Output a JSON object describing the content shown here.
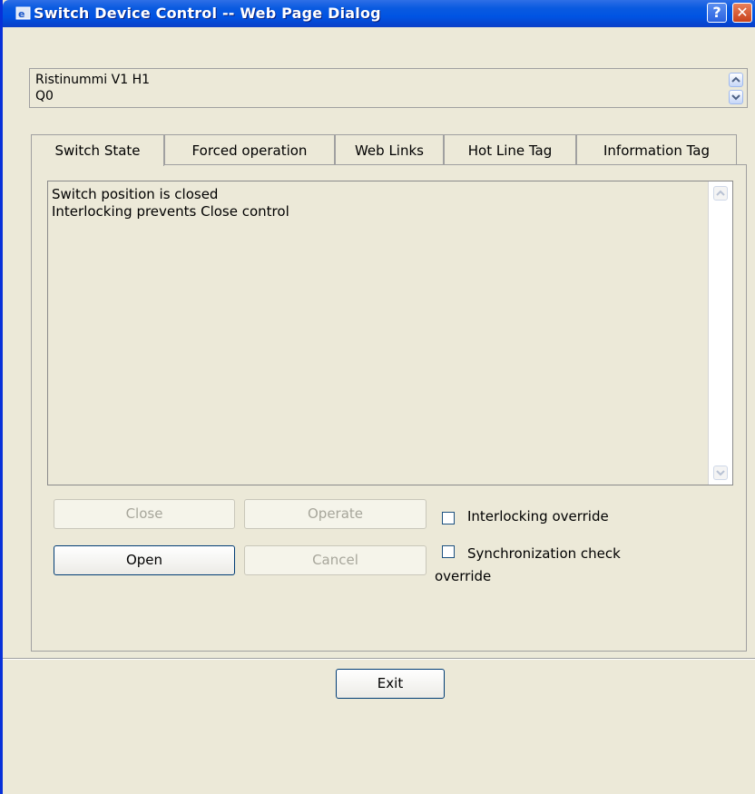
{
  "window": {
    "title": "Switch Device Control -- Web Page Dialog",
    "help_label": "?",
    "close_label": "✕"
  },
  "header": {
    "line1": "Ristinummi V1 H1",
    "line2": "Q0"
  },
  "tabs": [
    {
      "label": "Switch State",
      "active": true
    },
    {
      "label": "Forced operation",
      "active": false
    },
    {
      "label": "Web Links",
      "active": false
    },
    {
      "label": "Hot Line Tag",
      "active": false
    },
    {
      "label": "Information Tag",
      "active": false
    }
  ],
  "status": {
    "line1": "Switch position is closed",
    "line2": "Interlocking prevents Close control"
  },
  "buttons": {
    "close": "Close",
    "operate": "Operate",
    "open": "Open",
    "cancel": "Cancel",
    "exit": "Exit"
  },
  "checkboxes": {
    "interlocking_override": "Interlocking override",
    "sync_check_line1": "Synchronization check",
    "sync_check_line2": "override"
  },
  "colors": {
    "titlebar": "#0054e3",
    "dialog_bg": "#ece9d8",
    "disabled_text": "#a7a69b"
  }
}
